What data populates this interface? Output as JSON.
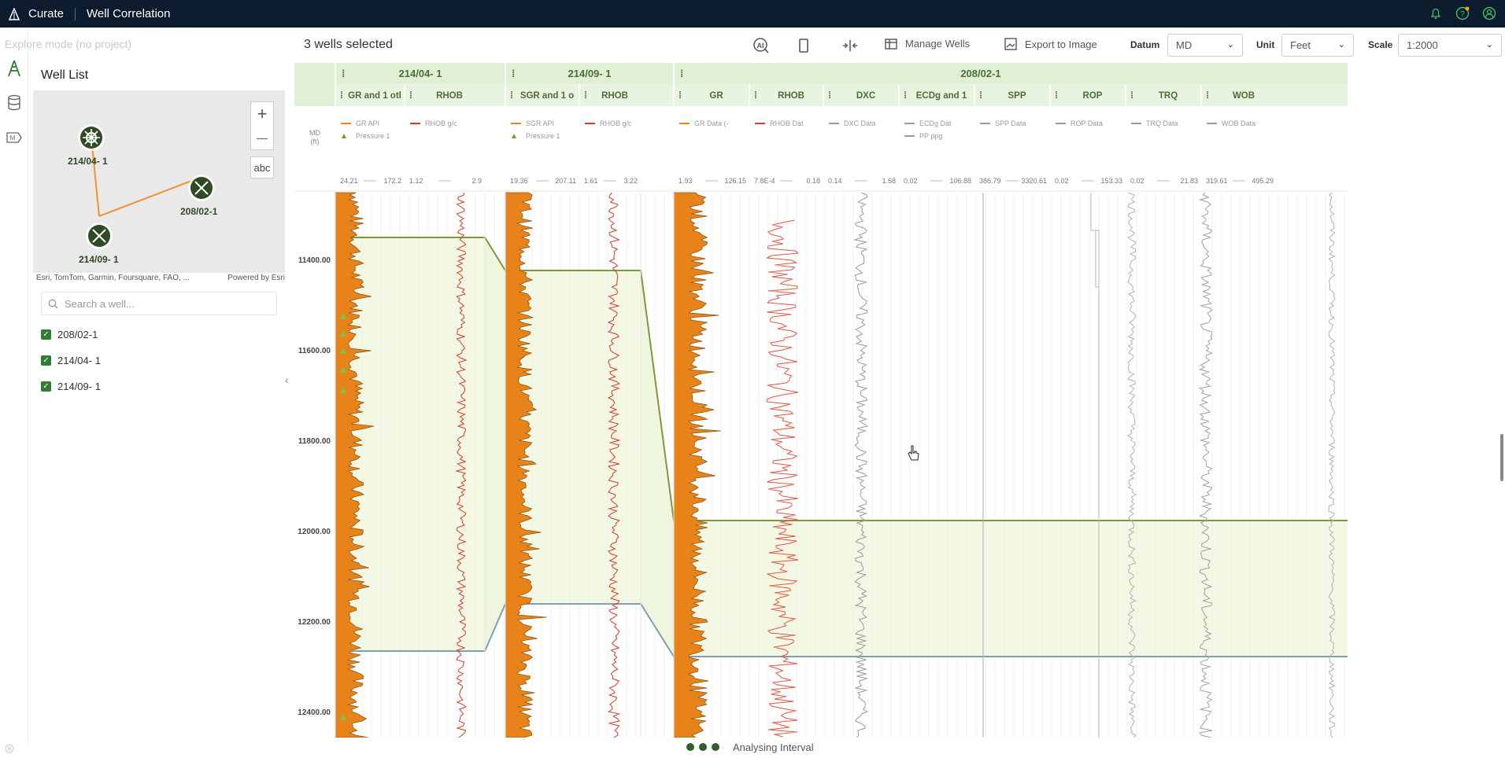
{
  "topbar": {
    "app_name": "Curate",
    "page_title": "Well Correlation"
  },
  "sidebar": {
    "mode_text": "Explore mode (no project)",
    "title": "Well List",
    "map": {
      "zoom_in": "+",
      "zoom_out": "—",
      "labels_button": "abc",
      "wells": [
        "214/04- 1",
        "208/02-1",
        "214/09- 1"
      ],
      "attribution_left": "Esri, TomTom, Garmin, Foursquare, FAO, ...",
      "attribution_right": "Powered by Esri"
    },
    "search_placeholder": "Search a well...",
    "items": [
      {
        "label": "208/02-1",
        "checked": true
      },
      {
        "label": "214/04- 1",
        "checked": true
      },
      {
        "label": "214/09- 1",
        "checked": true
      }
    ]
  },
  "toolbar": {
    "selection": "3 wells selected",
    "manage_wells": "Manage Wells",
    "export": "Export to Image",
    "datum_label": "Datum",
    "datum_value": "MD",
    "unit_label": "Unit",
    "unit_value": "Feet",
    "scale_label": "Scale",
    "scale_value": "1:2000"
  },
  "correlation": {
    "depth_header": "MD\n(ft)",
    "depth_ticks": [
      "11400.00",
      "11600.00",
      "11800.00",
      "12000.00",
      "12200.00",
      "12400.00"
    ],
    "wells": [
      {
        "name": "214/04- 1",
        "tracks": [
          {
            "name": "GR and 1 otl",
            "curves": [
              "GR API",
              "Pressure 1"
            ],
            "min": "24.21",
            "max": "172.2"
          },
          {
            "name": "RHOB",
            "curves": [
              "RHOB g/c"
            ],
            "min": "1.12",
            "max": "2.9"
          }
        ]
      },
      {
        "name": "214/09- 1",
        "tracks": [
          {
            "name": "SGR and 1 o",
            "curves": [
              "SGR API",
              "Pressure 1"
            ],
            "min": "19.36",
            "max": "207.11"
          },
          {
            "name": "RHOB",
            "curves": [
              "RHOB g/c"
            ],
            "min": "1.61",
            "max": "3.22"
          }
        ]
      },
      {
        "name": "208/02-1",
        "tracks": [
          {
            "name": "GR",
            "curves": [
              "GR Data (-"
            ],
            "min": "1.93",
            "max": "126.15"
          },
          {
            "name": "RHOB",
            "curves": [
              "RHOB Dat"
            ],
            "min": "7.8E-4",
            "max": "0.18"
          },
          {
            "name": "DXC",
            "curves": [
              "DXC Data"
            ],
            "min": "0.14",
            "max": "1.68"
          },
          {
            "name": "ECDg and 1",
            "curves": [
              "ECDg Dat",
              "PP ppg"
            ],
            "min": "0.02",
            "max": "106.88"
          },
          {
            "name": "SPP",
            "curves": [
              "SPP Data"
            ],
            "min": "386.79",
            "max": "3320.61"
          },
          {
            "name": "ROP",
            "curves": [
              "ROP Data"
            ],
            "min": "0.02",
            "max": "153.33"
          },
          {
            "name": "TRQ",
            "curves": [
              "TRQ Data"
            ],
            "min": "0.02",
            "max": "21.83"
          },
          {
            "name": "WOB",
            "curves": [
              "WOB Data"
            ],
            "min": "319.61",
            "max": "495.29"
          }
        ]
      }
    ]
  },
  "status": {
    "text": "Analysing Interval"
  }
}
